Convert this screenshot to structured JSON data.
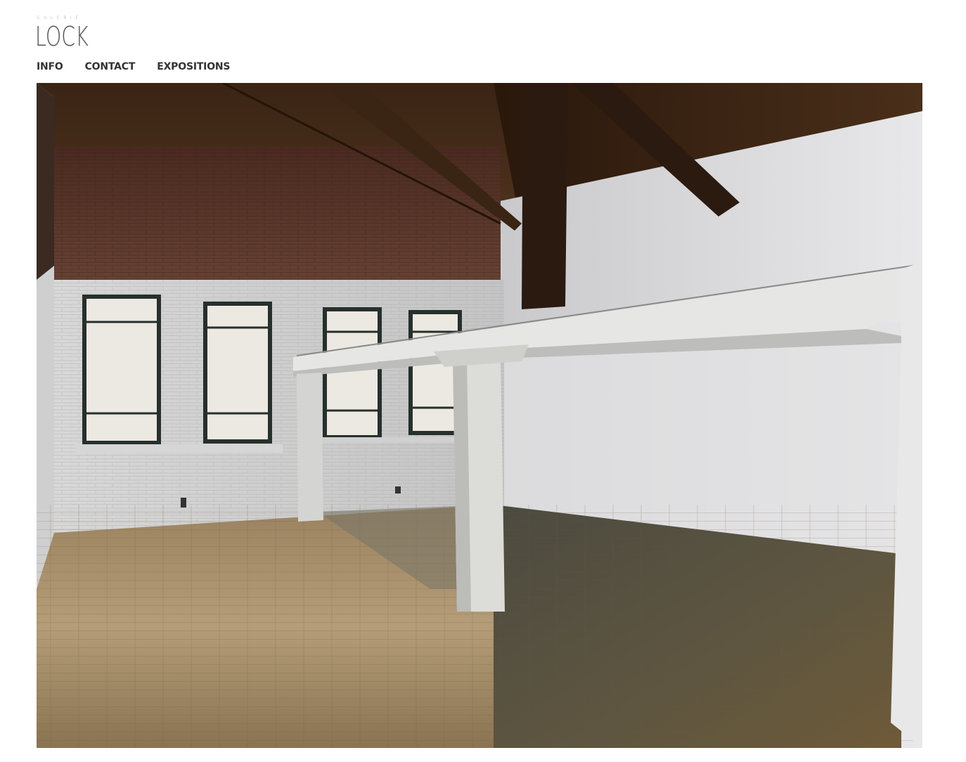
{
  "logo": {
    "small": "GALERIE",
    "big": "LOCK"
  },
  "nav": {
    "items": [
      {
        "label": "INFO"
      },
      {
        "label": "CONTACT"
      },
      {
        "label": "EXPOSITIONS"
      }
    ]
  },
  "photo": {
    "description_icon": "gallery-interior-photo"
  },
  "colors": {
    "text": "#333333",
    "logo": "#555555",
    "background": "#ffffff"
  }
}
